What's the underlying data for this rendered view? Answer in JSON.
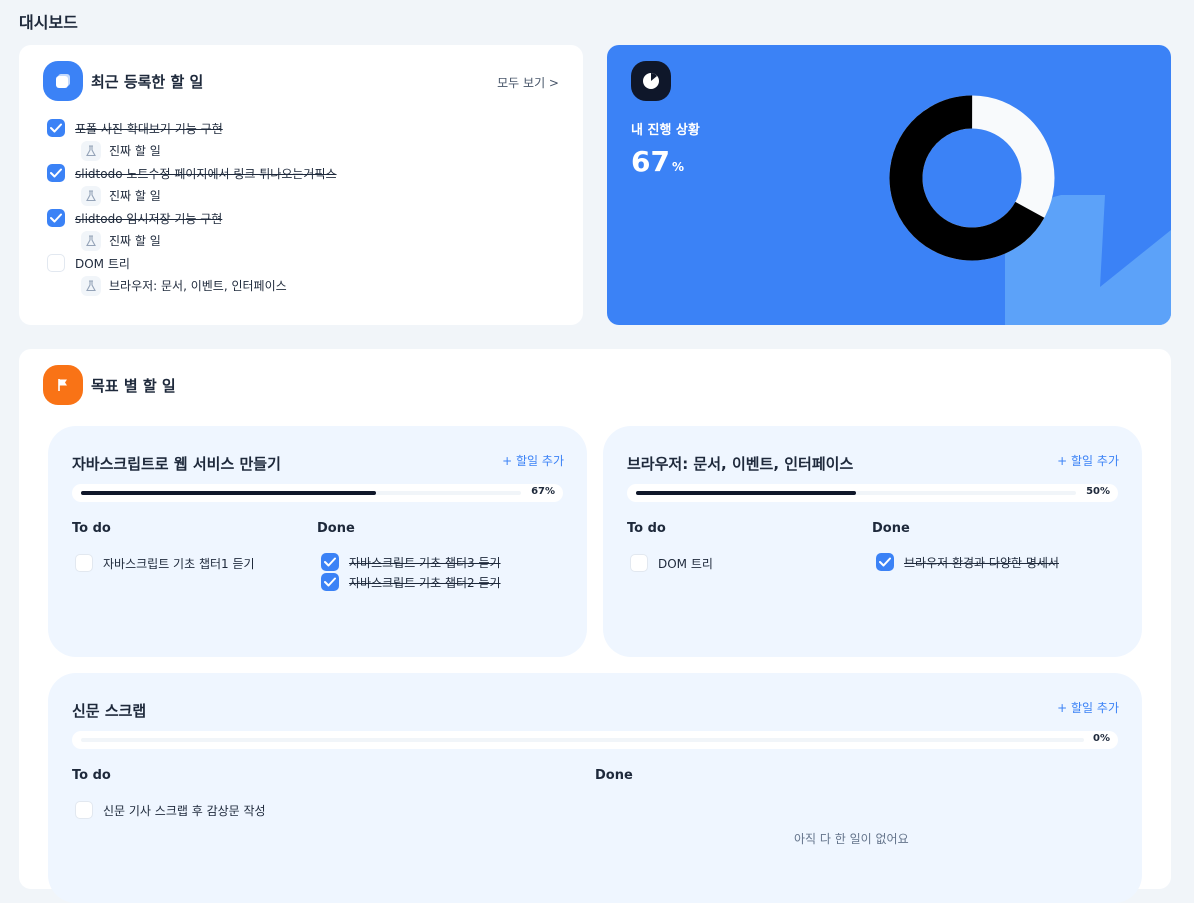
{
  "page": {
    "title": "대시보드"
  },
  "recent": {
    "title": "최근 등록한 할 일",
    "see_all": "모두 보기 >",
    "items": [
      {
        "text": "포폴 사진 확대보기 기능 구현",
        "done": true,
        "goal": "진짜 할 일"
      },
      {
        "text": "slidtodo 노트수정 페이지에서 링크 튀나오는거픽스",
        "done": true,
        "goal": "진짜 할 일"
      },
      {
        "text": "slidtodo 임시저장 기능 구현",
        "done": true,
        "goal": "진짜 할 일"
      },
      {
        "text": "DOM 트리",
        "done": false,
        "goal": "브라우저: 문서, 이벤트, 인터페이스"
      }
    ]
  },
  "progress": {
    "label": "내 진행 상황",
    "value": "67",
    "unit": "%",
    "percent": 67,
    "colors": {
      "bg": "#3B82F6",
      "done": "#000000",
      "rest": "#F8FAFC"
    }
  },
  "goals": {
    "title": "목표 별 할 일",
    "add_label": "+ 할일 추가",
    "todo_label": "To do",
    "done_label": "Done",
    "empty_done": "아직 다 한 일이 없어요",
    "items": [
      {
        "title": "자바스크립트로 웹 서비스 만들기",
        "percent_label": "67%",
        "percent": 67,
        "todo": [
          "자바스크립트 기초 챕터1 듣기"
        ],
        "done": [
          "자바스크립트 기초 챕터3 듣기",
          "자바스크립트 기초 챕터2 듣기"
        ]
      },
      {
        "title": "브라우저: 문서, 이벤트, 인터페이스",
        "percent_label": "50%",
        "percent": 50,
        "todo": [
          "DOM 트리"
        ],
        "done": [
          "브라우저 환경과 다양한 명세서"
        ]
      },
      {
        "title": "신문 스크랩",
        "percent_label": "0%",
        "percent": 0,
        "todo": [
          "신문 기사 스크랩 후 감상문 작성"
        ],
        "done": []
      }
    ]
  }
}
